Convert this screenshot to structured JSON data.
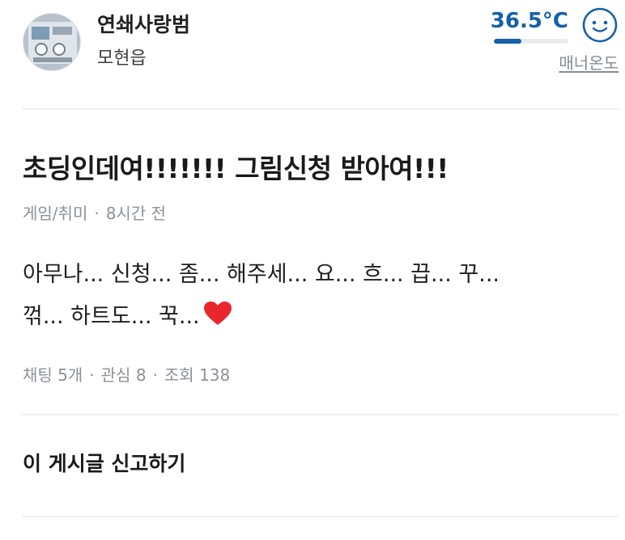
{
  "profile": {
    "nickname": "연쇄사랑범",
    "region": "모현읍",
    "manner_temp": "36.5°C",
    "manner_temp_level": 0.365,
    "manner_label": "매너온도",
    "face_icon": "smile-face-icon"
  },
  "post": {
    "title": "초딩인데여!!!!!!! 그림신청 받아여!!!",
    "category": "게임/취미",
    "time": "8시간 전",
    "body_line1": "아무나... 신청... 좀... 해주세... 요... 흐... 끕... 꾸...",
    "body_line2": "꺾... 하트도... 꾹...",
    "heart_icon": "red-heart-icon",
    "stats": {
      "chats": "채팅 5개",
      "interest": "관심 8",
      "views": "조회 138"
    }
  },
  "actions": {
    "report_label": "이 게시글 신고하기"
  },
  "colors": {
    "temp_blue": "#1561a9",
    "heart_red": "#e8262c",
    "muted": "#8c9199"
  }
}
